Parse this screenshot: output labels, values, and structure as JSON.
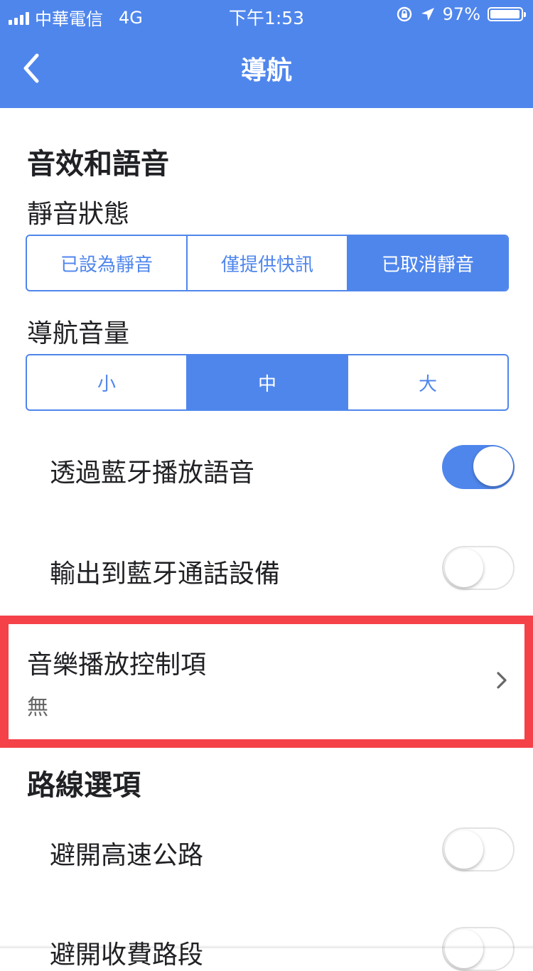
{
  "status_bar": {
    "carrier": "中華電信",
    "network": "4G",
    "time": "下午1:53",
    "battery_percent_text": "97%",
    "battery_level": 0.97,
    "icons": [
      "signal-bars-icon",
      "orientation-lock-icon",
      "location-arrow-icon",
      "battery-icon"
    ]
  },
  "header": {
    "title": "導航",
    "back_icon": "chevron-left-icon"
  },
  "sound_section": {
    "title": "音效和語音",
    "mute_state": {
      "label": "靜音狀態",
      "options": [
        "已設為靜音",
        "僅提供快訊",
        "已取消靜音"
      ],
      "selected": "已取消靜音"
    },
    "volume": {
      "label": "導航音量",
      "options": [
        "小",
        "中",
        "大"
      ],
      "selected": "中"
    },
    "bluetooth_voice": {
      "label": "透過藍牙播放語音",
      "on": true
    },
    "bluetooth_call": {
      "label": "輸出到藍牙通話設備",
      "on": false
    }
  },
  "music_controls": {
    "title": "音樂播放控制項",
    "value": "無",
    "chevron_icon": "chevron-right-icon"
  },
  "route_section": {
    "title": "路線選項",
    "avoid_highways": {
      "label": "避開高速公路",
      "on": false
    },
    "avoid_tolls": {
      "label": "避開收費路段",
      "on": false
    }
  },
  "colors": {
    "accent": "#4f86ec",
    "highlight_border": "#f44248",
    "text": "#202124",
    "secondary_text": "#666666"
  }
}
